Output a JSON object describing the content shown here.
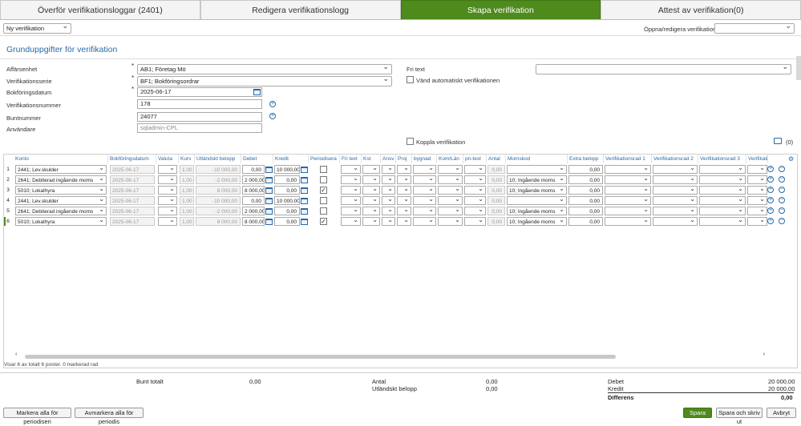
{
  "tabs": [
    {
      "label": "Överför verifikationsloggar (2401)",
      "active": false
    },
    {
      "label": "Redigera verifikationslogg",
      "active": false
    },
    {
      "label": "Skapa verifikation",
      "active": true
    },
    {
      "label": "Attest av verifikation(0)",
      "active": false
    }
  ],
  "toolbar": {
    "mode_select": "Ny verifikation",
    "open_edit_label": "Öppna/redigera verifikation",
    "open_edit_value": ""
  },
  "section_title": "Grunduppgifter för verifikation",
  "form": {
    "affarsenhet_label": "Affärsenhet",
    "affarsenhet_value": "AB1; Företag Mö",
    "serie_label": "Verifikationsserie",
    "serie_value": "BF1; Bokföringsordrar",
    "datum_label": "Bokföringsdatum",
    "datum_value": "2025-06-17",
    "nummer_label": "Verifikationsnummer",
    "nummer_value": "178",
    "bunt_label": "Buntnummer",
    "bunt_value": "24077",
    "anvandare_label": "Användare",
    "anvandare_value": "sqladmin-CPL",
    "fritext_label": "Fri text",
    "fritext_value": "",
    "vand_label": "Vänd automatiskt verifikationen",
    "koppla_label": "Koppla verifikation",
    "attach_count": "(0)"
  },
  "grid": {
    "headers": [
      "Konto",
      "Bokföringsdatum",
      "Valuta",
      "Kurs",
      "Utländskt belopp",
      "Debet",
      "Kredit",
      "Periodisera",
      "Fri text",
      "Kst",
      "Ansv",
      "Proj",
      "bygnad",
      "Kom/Län",
      "pn-test",
      "Antal",
      "Momskod",
      "Extra belopp",
      "Verifikationsrad 1",
      "Verifikationsrad 2",
      "Verifikationsrad 3",
      "Verifikati"
    ],
    "rows": [
      {
        "n": "1",
        "konto": "2441; Lev.skulder",
        "datum": "2025-06-17",
        "kurs": "1,00",
        "utl": "-10 000,00",
        "debet": "0,00",
        "kredit": "10 000,00",
        "periodisera": false,
        "antal": "0,00",
        "moms": "",
        "extra": "0,00"
      },
      {
        "n": "2",
        "konto": "2641; Debiterad ingående moms",
        "datum": "2025-06-17",
        "kurs": "1,00",
        "utl": "-2 000,00",
        "debet": "2 000,00",
        "kredit": "0,00",
        "periodisera": false,
        "antal": "0,00",
        "moms": "10; Ingående moms",
        "extra": "0,00"
      },
      {
        "n": "3",
        "konto": "5010; Lokalhyra",
        "datum": "2025-06-17",
        "kurs": "1,00",
        "utl": "8 000,00",
        "debet": "8 000,00",
        "kredit": "0,00",
        "periodisera": true,
        "antal": "0,00",
        "moms": "10; Ingående moms",
        "extra": "0,00"
      },
      {
        "n": "4",
        "konto": "2441; Lev.skulder",
        "datum": "2025-06-17",
        "kurs": "1,00",
        "utl": "-10 000,00",
        "debet": "0,00",
        "kredit": "10 000,00",
        "periodisera": false,
        "antal": "0,00",
        "moms": "",
        "extra": "0,00"
      },
      {
        "n": "5",
        "konto": "2641; Debiterad ingående moms",
        "datum": "2025-06-17",
        "kurs": "1,00",
        "utl": "-2 000,00",
        "debet": "2 000,00",
        "kredit": "0,00",
        "periodisera": false,
        "antal": "0,00",
        "moms": "10; Ingående moms",
        "extra": "0,00"
      },
      {
        "n": "6",
        "konto": "5010; Lokalhyra",
        "datum": "2025-06-17",
        "kurs": "1,00",
        "utl": "8 000,00",
        "debet": "8 000,00",
        "kredit": "0,00",
        "periodisera": true,
        "antal": "0,00",
        "moms": "10; Ingående moms",
        "extra": "0,00"
      }
    ],
    "status": "Visar 6 av totalt 6 poster. 0 markerad rad"
  },
  "summary": {
    "bunt_label": "Bunt totalt",
    "bunt_value": "0,00",
    "antal_label": "Antal",
    "antal_value": "0,00",
    "utl_label": "Utländskt belopp",
    "utl_value": "0,00",
    "debet_label": "Debet",
    "debet_value": "20 000,00",
    "kredit_label": "Kredit",
    "kredit_value": "20 000,00",
    "diff_label": "Differens",
    "diff_value": "0,00"
  },
  "buttons": {
    "markera": "Markera alla för periodiseri",
    "avmarkera": "Avmarkera alla för periodis",
    "spara": "Spara",
    "spara_skriv": "Spara och skriv ut",
    "avbryt": "Avbryt"
  },
  "colors": {
    "accent_green": "#4e8a1c",
    "link_blue": "#2b6aa8"
  }
}
